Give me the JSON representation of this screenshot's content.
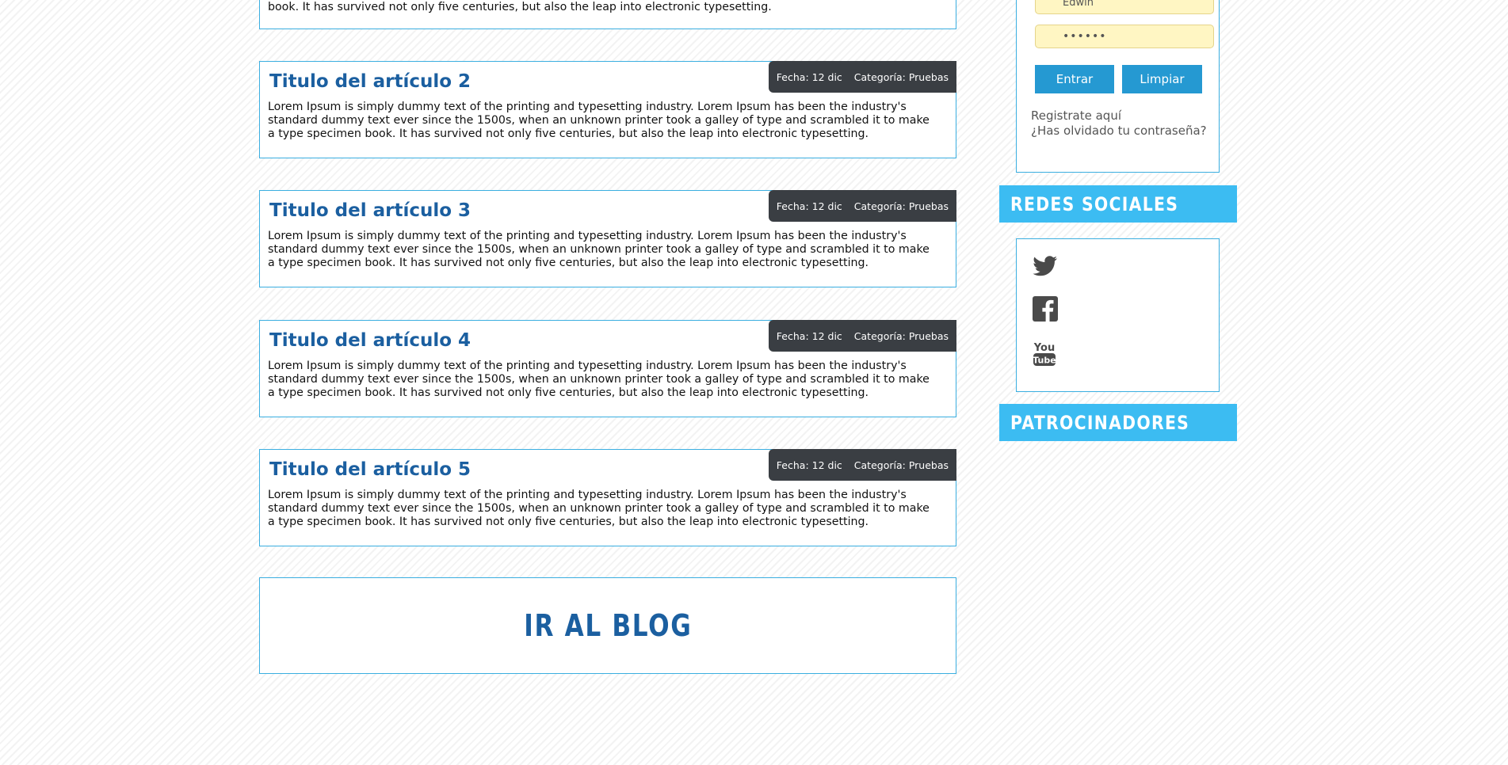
{
  "articles": {
    "top_partial": {
      "body": "book. It has survived not only five centuries, but also the leap into electronic typesetting."
    },
    "items": [
      {
        "title": "Titulo del artículo 2",
        "date": "Fecha: 12 dic",
        "category": "Categoría: Pruebas",
        "body": "Lorem Ipsum is simply dummy text of the printing and typesetting industry. Lorem Ipsum has been the industry's standard dummy text ever since the 1500s, when an unknown printer took a galley of type and scrambled it to make a type specimen book. It has survived not only five centuries, but also the leap into electronic typesetting."
      },
      {
        "title": "Titulo del artículo 3",
        "date": "Fecha: 12 dic",
        "category": "Categoría: Pruebas",
        "body": "Lorem Ipsum is simply dummy text of the printing and typesetting industry. Lorem Ipsum has been the industry's standard dummy text ever since the 1500s, when an unknown printer took a galley of type and scrambled it to make a type specimen book. It has survived not only five centuries, but also the leap into electronic typesetting."
      },
      {
        "title": "Titulo del artículo 4",
        "date": "Fecha: 12 dic",
        "category": "Categoría: Pruebas",
        "body": "Lorem Ipsum is simply dummy text of the printing and typesetting industry. Lorem Ipsum has been the industry's standard dummy text ever since the 1500s, when an unknown printer took a galley of type and scrambled it to make a type specimen book. It has survived not only five centuries, but also the leap into electronic typesetting."
      },
      {
        "title": "Titulo del artículo 5",
        "date": "Fecha: 12 dic",
        "category": "Categoría: Pruebas",
        "body": "Lorem Ipsum is simply dummy text of the printing and typesetting industry. Lorem Ipsum has been the industry's standard dummy text ever since the 1500s, when an unknown printer took a galley of type and scrambled it to make a type specimen book. It has survived not only five centuries, but also the leap into electronic typesetting."
      }
    ]
  },
  "blog_link": {
    "label": "IR AL BLOG"
  },
  "login": {
    "username_value": "Edwin",
    "password_value": "••••••",
    "enter_label": "Entrar",
    "clear_label": "Limpiar",
    "register_link": "Registrate aquí",
    "forgot_link": "¿Has olvidado tu contraseña?"
  },
  "social": {
    "title": "REDES SOCIALES",
    "icons": [
      "twitter-icon",
      "facebook-icon",
      "youtube-icon"
    ]
  },
  "sponsors": {
    "title": "PATROCINADORES"
  },
  "colors": {
    "accent_blue": "#3cbcf2",
    "border_blue": "#3aaee0",
    "title_blue": "#1b5fa0",
    "button_blue": "#2599d2",
    "meta_dark": "#3a3e43",
    "input_yellow": "#fff6c3"
  }
}
